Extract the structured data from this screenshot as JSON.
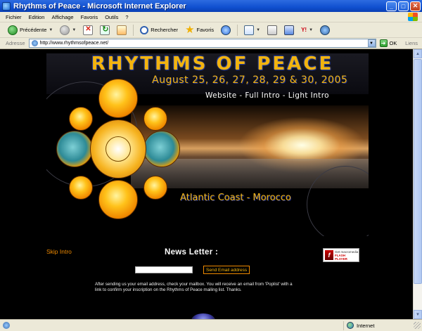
{
  "window": {
    "title": "Rhythms of Peace - Microsoft Internet Explorer",
    "buttons": [
      "_",
      "□",
      "✕"
    ]
  },
  "menu": [
    "Fichier",
    "Edition",
    "Affichage",
    "Favoris",
    "Outils",
    "?"
  ],
  "toolbar": {
    "back_label": "Précédente",
    "search_label": "Rechercher",
    "favorites_label": "Favoris"
  },
  "address": {
    "label": "Adresse",
    "url": "http://www.rhythmsofpeace.net/",
    "go_label": "OK",
    "links_label": "Liens"
  },
  "page": {
    "title": "RHYTHMS OF PEACE",
    "dates": "August 25, 26, 27, 28, 29 & 30, 2005",
    "intro_links": {
      "website": "Website",
      "full_intro": "Full Intro",
      "light_intro": "Light Intro",
      "separator": " - "
    },
    "location": "Atlantic Coast - Morocco",
    "skip_intro": "Skip Intro",
    "newsletter_title": "News Letter :",
    "email_value": "",
    "send_button": "Send Email address",
    "info": "After sending us your email address, check your mailbox. You will receive an email from 'Poplist' with a link to confirm your inscription on the Rhythms of Peace mailing list. Thanks.",
    "flash_badge": {
      "line1": "Get macromedia",
      "line2": "FLASH",
      "line3": "PLAYER"
    }
  },
  "status": {
    "text": "",
    "zone": "Internet"
  },
  "colors": {
    "accent_orange": "#f08a00",
    "title_gold": "#f3b40e",
    "page_bg": "#000000"
  }
}
